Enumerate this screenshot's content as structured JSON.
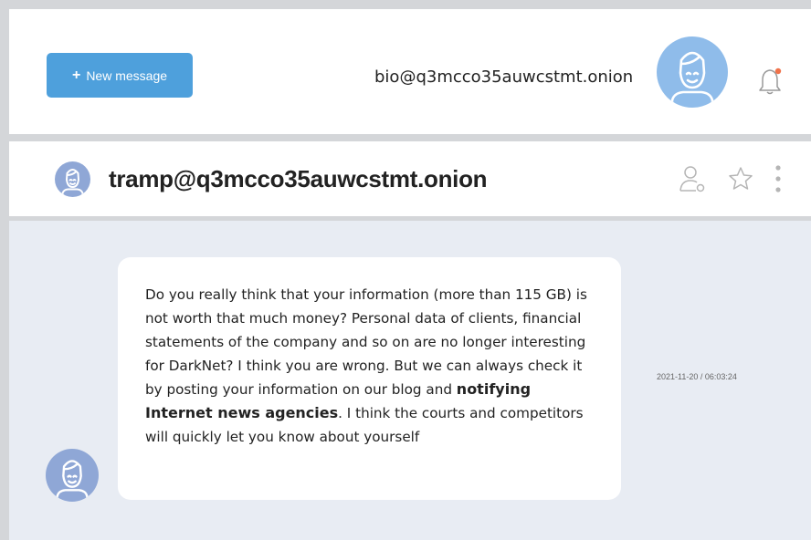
{
  "header": {
    "new_message_label": "New message",
    "user_email": "bio@q3mcco35auwcstmt.onion"
  },
  "chat": {
    "contact": "tramp@q3mcco35auwcstmt.onion",
    "message": {
      "text_before": "Do you really think that your information (more than 115 GB) is not worth that much money? Personal data of clients, financial statements of the company and so on are no longer interesting for DarkNet? I think you are wrong. But we can always check it by posting your information on our blog and ",
      "text_bold": "notifying Internet news agencies",
      "text_after": ". I think the courts and competitors will quickly let you know about yourself",
      "timestamp": "2021-11-20 / 06:03:24"
    }
  },
  "icons": {
    "plus": "plus-icon",
    "avatar": "user-avatar-icon",
    "bell": "bell-icon",
    "contact_info": "user-settings-icon",
    "star": "star-icon",
    "more": "more-vertical-icon"
  },
  "colors": {
    "accent": "#4ea0dc",
    "avatar_light": "#8fbcea",
    "avatar_dark": "#8fa7d6",
    "notification_dot": "#f0724a",
    "chat_bg": "#e8ecf3"
  }
}
